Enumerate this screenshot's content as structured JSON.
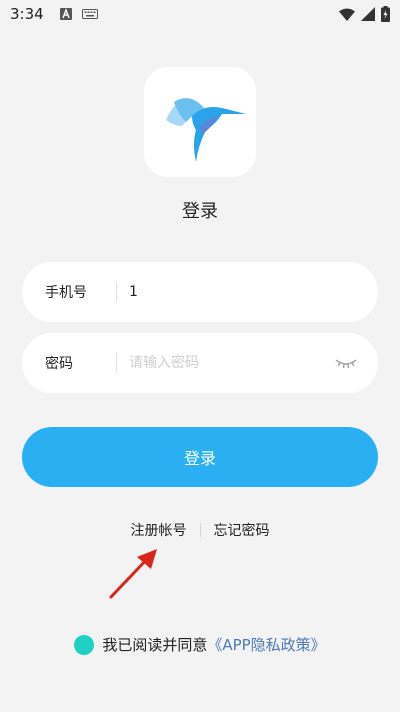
{
  "status_bar": {
    "time": "3:34",
    "icons_left": [
      "text-a-icon",
      "keyboard-icon"
    ],
    "icons_right": [
      "wifi-icon",
      "signal-icon",
      "battery-charging-icon"
    ]
  },
  "logo": {
    "icon": "hummingbird-logo-icon",
    "colors": [
      "#9fd3f3",
      "#2aa3ea",
      "#5e86d8"
    ]
  },
  "title": "登录",
  "phone_field": {
    "label": "手机号",
    "value": "1"
  },
  "password_field": {
    "label": "密码",
    "placeholder": "请输入密码",
    "toggle_icon": "eye-closed-icon"
  },
  "login_button": {
    "label": "登录",
    "color": "#2ab0f2"
  },
  "links": {
    "register": "注册帐号",
    "forgot_password": "忘记密码"
  },
  "agreement": {
    "text": "我已阅读并同意",
    "policy_link": "《APP隐私政策》",
    "checkbox_color": "#1fd0c4"
  }
}
